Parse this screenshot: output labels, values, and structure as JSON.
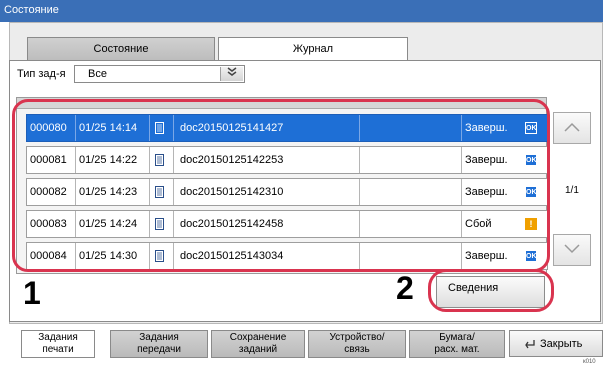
{
  "window": {
    "title": "Состояние"
  },
  "tabs": [
    {
      "label": "Состояние",
      "active": false
    },
    {
      "label": "Журнал",
      "active": true
    }
  ],
  "filter": {
    "label": "Тип зад-я",
    "value": "Все",
    "arrow_icon": "double-chevron-down-icon"
  },
  "jobs": [
    {
      "id": "000080",
      "time": "01/25 14:14",
      "name": "doc20150125141427",
      "status": "Заверш.",
      "status_icon": "ok-icon",
      "selected": true
    },
    {
      "id": "000081",
      "time": "01/25 14:22",
      "name": "doc20150125142253",
      "status": "Заверш.",
      "status_icon": "ok-icon",
      "selected": false
    },
    {
      "id": "000082",
      "time": "01/25 14:23",
      "name": "doc20150125142310",
      "status": "Заверш.",
      "status_icon": "ok-icon",
      "selected": false
    },
    {
      "id": "000083",
      "time": "01/25 14:24",
      "name": "doc20150125142458",
      "status": "Сбой",
      "status_icon": "warning-icon",
      "selected": false
    },
    {
      "id": "000084",
      "time": "01/25 14:30",
      "name": "doc20150125143034",
      "status": "Заверш.",
      "status_icon": "ok-icon",
      "selected": false
    }
  ],
  "ok_label": "OK",
  "warn_label": "!",
  "pager": {
    "indicator": "1/1",
    "up_icon": "chevron-up-icon",
    "down_icon": "chevron-down-icon"
  },
  "details_button": {
    "label": "Сведения"
  },
  "callouts": {
    "one": "1",
    "two": "2"
  },
  "bottom_tabs": [
    {
      "line1": "Задания",
      "line2": "печати",
      "active": true
    },
    {
      "line1": "Задания",
      "line2": "передачи",
      "active": false
    },
    {
      "line1": "Сохранение",
      "line2": "заданий",
      "active": false
    },
    {
      "line1": "Устройство/",
      "line2": "связь",
      "active": false
    },
    {
      "line1": "Бумага/",
      "line2": "расх. мат.",
      "active": false
    }
  ],
  "close_button": {
    "label": "Закрыть",
    "icon": "return-arrow-icon"
  },
  "corner_code": "к010",
  "colors": {
    "title_bar": "#3a6fb7",
    "selected_row": "#1e6fd6",
    "callout_ring": "#d9344f",
    "warning": "#f0a000"
  }
}
